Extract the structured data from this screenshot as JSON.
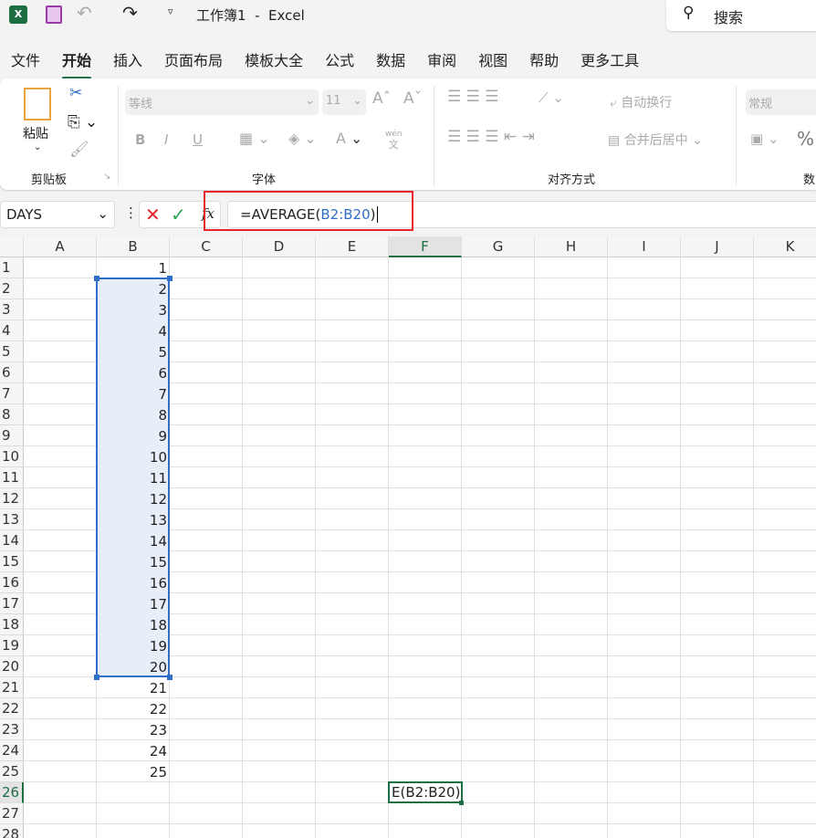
{
  "titlebar": {
    "title": "工作簿1  -  Excel",
    "search": "搜索"
  },
  "tabs": [
    "文件",
    "开始",
    "插入",
    "页面布局",
    "模板大全",
    "公式",
    "数据",
    "审阅",
    "视图",
    "帮助",
    "更多工具"
  ],
  "active_tab": "开始",
  "ribbon": {
    "paste": "粘贴",
    "clipboard": "剪贴板",
    "font_name": "等线",
    "font_size": "11",
    "font": "字体",
    "alignment": "对齐方式",
    "wrap": "自动换行",
    "merge": "合并后居中",
    "number_format": "常规",
    "number": "数",
    "bold": "B",
    "italic": "I",
    "underline": "U",
    "phonetic_top": "wén",
    "phonetic_bottom": "文",
    "percent": "%"
  },
  "formula_bar": {
    "name_box": "DAYS",
    "formula_prefix": "=AVERAGE(",
    "formula_ref": "B2:B20",
    "formula_suffix": ")",
    "fx": "fx"
  },
  "columns": [
    "A",
    "B",
    "C",
    "D",
    "E",
    "F",
    "G",
    "H",
    "I",
    "J",
    "K"
  ],
  "rows": [
    "1",
    "2",
    "3",
    "4",
    "5",
    "6",
    "7",
    "8",
    "9",
    "10",
    "11",
    "12",
    "13",
    "14",
    "15",
    "16",
    "17",
    "18",
    "19",
    "20",
    "21",
    "22",
    "23",
    "24",
    "25",
    "26",
    "27",
    "28"
  ],
  "column_b_values": [
    "1",
    "2",
    "3",
    "4",
    "5",
    "6",
    "7",
    "8",
    "9",
    "10",
    "11",
    "12",
    "13",
    "14",
    "15",
    "16",
    "17",
    "18",
    "19",
    "20",
    "21",
    "22",
    "23",
    "24",
    "25"
  ],
  "active_cell": {
    "ref": "F26",
    "display": "E(B2:B20)"
  },
  "colors": {
    "accent": "#1e6e43",
    "range": "#2f6fc7",
    "highlight": "#e8232a"
  }
}
